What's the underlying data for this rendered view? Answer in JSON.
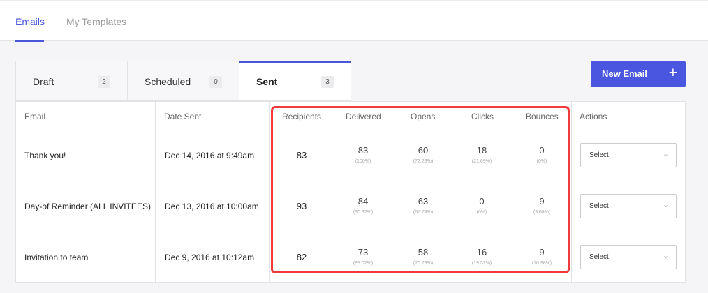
{
  "top_tabs": [
    {
      "label": "Emails",
      "active": true
    },
    {
      "label": "My Templates",
      "active": false
    }
  ],
  "sub_tabs": [
    {
      "label": "Draft",
      "count": "2"
    },
    {
      "label": "Scheduled",
      "count": "0"
    },
    {
      "label": "Sent",
      "count": "3",
      "active": true
    }
  ],
  "new_email_button": {
    "label": "New Email",
    "icon": "plus-icon",
    "color": "#4a56e0"
  },
  "table": {
    "headers": {
      "email": "Email",
      "date_sent": "Date Sent",
      "recipients": "Recipients",
      "delivered": "Delivered",
      "opens": "Opens",
      "clicks": "Clicks",
      "bounces": "Bounces",
      "actions": "Actions"
    },
    "rows": [
      {
        "email": "Thank you!",
        "date_sent": "Dec 14, 2016 at 9:49am",
        "recipients": "83",
        "delivered": "83",
        "delivered_pct": "(100%)",
        "opens": "60",
        "opens_pct": "(72.29%)",
        "clicks": "18",
        "clicks_pct": "(21.69%)",
        "bounces": "0",
        "bounces_pct": "(0%)",
        "action": "Select"
      },
      {
        "email": "Day-of Reminder (ALL INVITEES)",
        "date_sent": "Dec 13, 2016 at 10:00am",
        "recipients": "93",
        "delivered": "84",
        "delivered_pct": "(90.32%)",
        "opens": "63",
        "opens_pct": "(67.74%)",
        "clicks": "0",
        "clicks_pct": "(0%)",
        "bounces": "9",
        "bounces_pct": "(9.68%)",
        "action": "Select"
      },
      {
        "email": "Invitation to team",
        "date_sent": "Dec 9, 2016 at 10:12am",
        "recipients": "82",
        "delivered": "73",
        "delivered_pct": "(89.02%)",
        "opens": "58",
        "opens_pct": "(70.73%)",
        "clicks": "16",
        "clicks_pct": "(19.51%)",
        "bounces": "9",
        "bounces_pct": "(10.98%)",
        "action": "Select"
      }
    ]
  },
  "select_chevron": "chevron-down-icon",
  "highlight_color": "#ef3b3b",
  "accent_color": "#4a56d8"
}
